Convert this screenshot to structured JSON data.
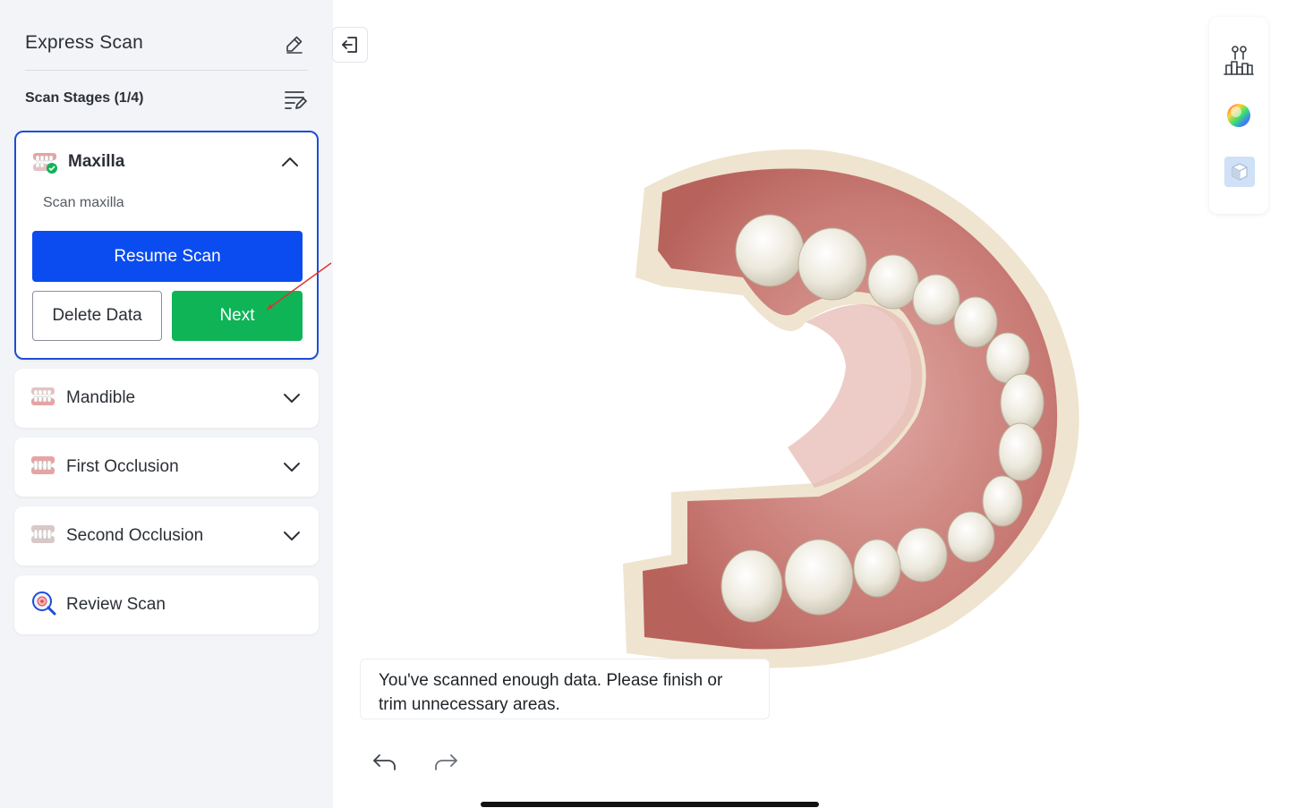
{
  "sidebar": {
    "title": "Express Scan",
    "stages_label": "Scan Stages (1/4)",
    "stages": [
      {
        "label": "Maxilla",
        "subtitle": "Scan maxilla",
        "expanded": true,
        "completed": true
      },
      {
        "label": "Mandible",
        "expanded": false
      },
      {
        "label": "First Occlusion",
        "expanded": false
      },
      {
        "label": "Second Occlusion",
        "expanded": false
      },
      {
        "label": "Review Scan"
      }
    ],
    "buttons": {
      "resume": "Resume Scan",
      "delete": "Delete Data",
      "next": "Next"
    }
  },
  "viewer": {
    "message": "You've scanned enough data. Please finish or trim unnecessary areas.",
    "model": "maxilla-3d-scan"
  },
  "tools": [
    "trim-tool-icon",
    "color-wheel-icon",
    "cube-view-icon"
  ],
  "history": [
    "undo-icon",
    "redo-icon"
  ],
  "colors": {
    "accent": "#0a4cf0",
    "success": "#0fb457",
    "active_border": "#1d4ed8",
    "sidebar_bg": "#f3f4f7"
  }
}
